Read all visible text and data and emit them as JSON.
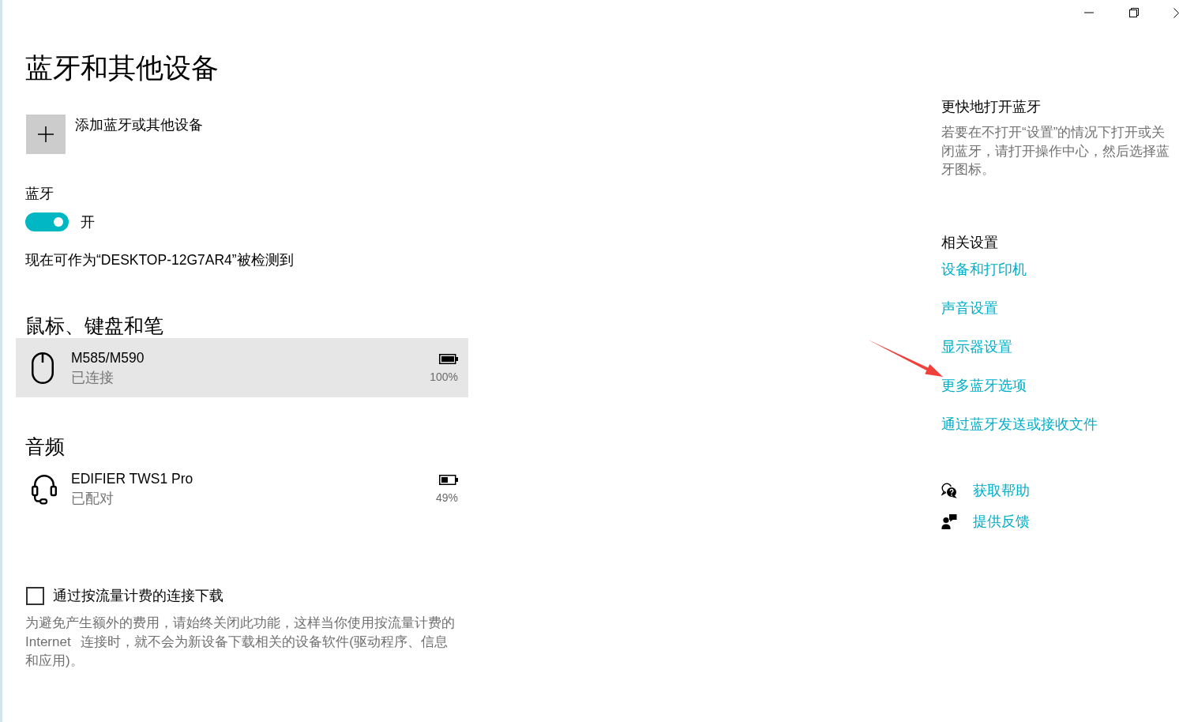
{
  "window_controls": [
    {
      "kind": "minimize"
    },
    {
      "kind": "restore"
    },
    {
      "kind": "close"
    }
  ],
  "title": "蓝牙和其他设备",
  "add_device": {
    "label": "添加蓝牙或其他设备"
  },
  "bluetooth": {
    "label": "蓝牙",
    "on": true,
    "state_label": "开",
    "discoverable_text": "现在可作为“DESKTOP-12G7AR4”被检测到"
  },
  "device_groups": [
    {
      "title": "鼠标、键盘和笔",
      "devices": [
        {
          "kind": "mouse",
          "name": "M585/M590",
          "status": "已连接",
          "battery": {
            "kind": "full",
            "reading": "100%"
          },
          "selected": true
        }
      ]
    },
    {
      "title": "音频",
      "devices": [
        {
          "kind": "headset",
          "name": "EDIFIER TWS1 Pro",
          "status": "已配对",
          "battery": {
            "kind": "half",
            "reading": "49%"
          },
          "selected": false
        }
      ]
    }
  ],
  "metered_download": {
    "label": "通过按流量计费的连接下载",
    "checked": false,
    "description": "为避免产生额外的费用，请始终关闭此功能，这样当你使用按流量计费的 Internet 连接时，就不会为新设备下载相关的设备软件(驱动程序、信息和应用)。"
  },
  "quick_tip": {
    "title": "更快地打开蓝牙",
    "text": "若要在不打开“设置”的情况下打开或关闭蓝牙，请打开操作中心，然后选择蓝牙图标。"
  },
  "related_settings": {
    "title": "相关设置",
    "links": [
      {
        "label": "设备和打印机",
        "marked": false
      },
      {
        "label": "声音设置",
        "marked": false
      },
      {
        "label": "显示器设置",
        "marked": false
      },
      {
        "label": "更多蓝牙选项",
        "marked": true
      },
      {
        "label": "通过蓝牙发送或接收文件",
        "marked": false
      }
    ]
  },
  "support_links": [
    {
      "kind": "help",
      "label": "获取帮助"
    },
    {
      "kind": "feedback",
      "label": "提供反馈"
    }
  ]
}
